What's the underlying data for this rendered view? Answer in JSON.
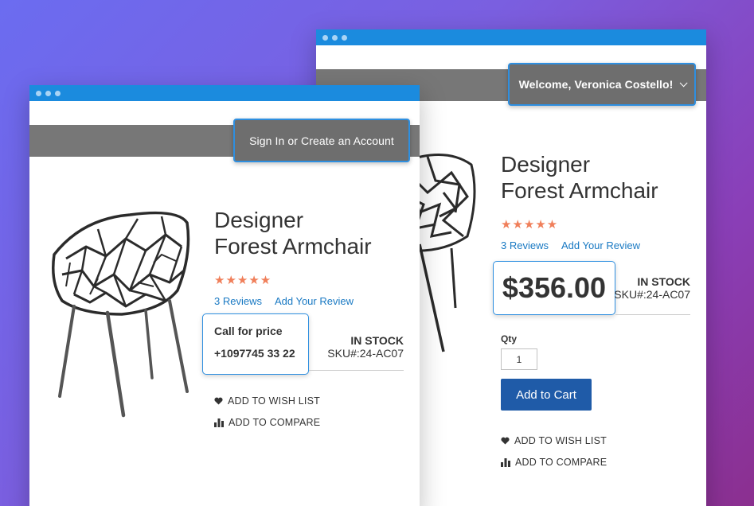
{
  "back_window": {
    "account": {
      "label": "Welcome, Veronica Costello!",
      "icon": "chevron-down-icon"
    },
    "product": {
      "title_line1": "Designer",
      "title_line2": "Forest Armchair",
      "stars": "★★★★★",
      "rating": 5,
      "reviews_link": "3 Reviews",
      "add_review_link": "Add Your Review",
      "price": "$356.00",
      "stock": "IN STOCK",
      "sku": "SKU#:24-AC07",
      "qty_label": "Qty",
      "qty_value": "1",
      "add_to_cart": "Add to Cart",
      "wishlist": "ADD TO WISH LIST",
      "compare": "ADD TO COMPARE"
    }
  },
  "front_window": {
    "account": {
      "label": "Sign In or Create an Account"
    },
    "product": {
      "title_line1": "Designer",
      "title_line2": "Forest Armchair",
      "stars": "★★★★★",
      "rating": 5,
      "reviews_link": "3 Reviews",
      "add_review_link": "Add Your Review",
      "call_for_price": "Call for price",
      "phone": "+1097745 33 22",
      "stock": "IN STOCK",
      "sku": "SKU#:24-AC07",
      "wishlist": "ADD TO WISH LIST",
      "compare": "ADD TO COMPARE"
    }
  },
  "colors": {
    "titlebar": "#1b8bde",
    "header_bar": "#777777",
    "highlight_border": "#2e8fe0",
    "stars": "#f07f5a",
    "link": "#1979c3",
    "cart_button": "#1f5ba8"
  }
}
